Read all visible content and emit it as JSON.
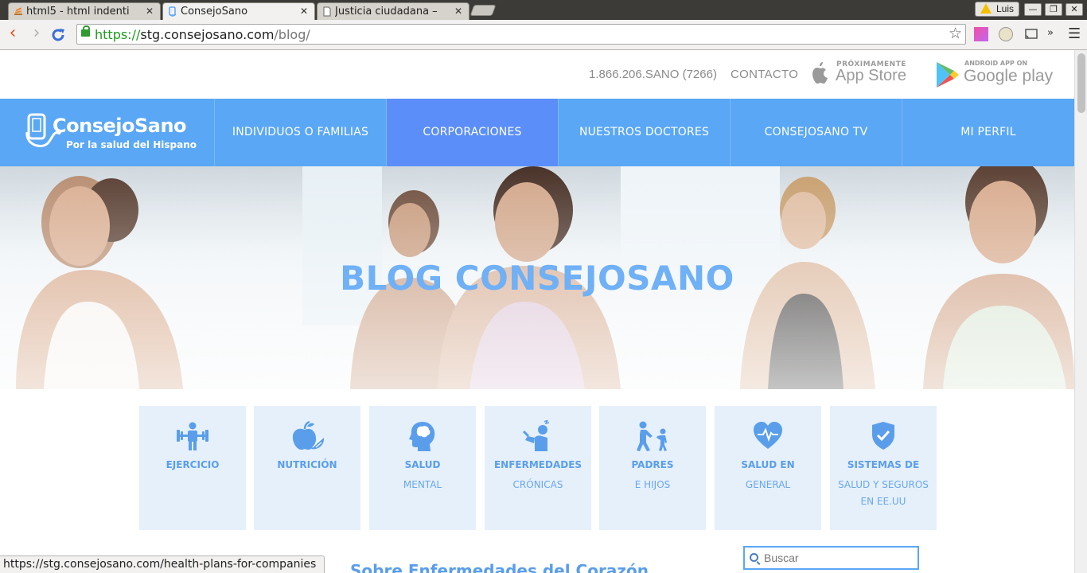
{
  "browser": {
    "tabs": [
      {
        "title": "html5 - html indenti",
        "active": false,
        "icon": "stackoverflow-icon"
      },
      {
        "title": "ConsejoSano",
        "active": true,
        "icon": "consejosano-favicon"
      },
      {
        "title": "Justicia ciudadana –",
        "active": false,
        "icon": "page-icon"
      }
    ],
    "profile_name": "Luis",
    "url_scheme": "https://",
    "url_host": "stg.consejosano.com",
    "url_path": "/blog/",
    "status_url": "https://stg.consejosano.com/health-plans-for-companies",
    "colors": {
      "secure": "#1c9a1c",
      "tab_active": "#f2f1f0"
    }
  },
  "header": {
    "phone": "1.866.206.SANO (7266)",
    "contact": "CONTACTO",
    "appstore_small": "PRÓXIMAMENTE",
    "appstore_big": "App Store",
    "gplay_small": "ANDROID APP ON",
    "gplay_big": "Google play"
  },
  "nav": {
    "brand": "ConsejoSano",
    "tagline": "Por la salud del Hispano",
    "items": [
      {
        "label": "INDIVIDUOS O FAMILIAS",
        "active": false
      },
      {
        "label": "CORPORACIONES",
        "active": true
      },
      {
        "label": "NUESTROS DOCTORES",
        "active": false
      },
      {
        "label": "CONSEJOSANO TV",
        "active": false
      },
      {
        "label": "MI PERFIL",
        "active": false
      }
    ],
    "colors": {
      "bar": "#5aa7f6",
      "active": "#5b8ef9"
    }
  },
  "hero": {
    "title": "BLOG CONSEJOSANO"
  },
  "categories": [
    {
      "line1": "EJERCICIO",
      "line2": "",
      "line3": "",
      "icon": "dumbbell-person-icon"
    },
    {
      "line1": "NUTRICIÓN",
      "line2": "",
      "line3": "",
      "icon": "apple-icon"
    },
    {
      "line1": "SALUD",
      "line2": "MENTAL",
      "line3": "",
      "icon": "head-brain-icon"
    },
    {
      "line1": "ENFERMEDADES",
      "line2": "CRÓNICAS",
      "line3": "",
      "icon": "sick-person-icon"
    },
    {
      "line1": "PADRES",
      "line2": "E HIJOS",
      "line3": "",
      "icon": "parent-child-icon"
    },
    {
      "line1": "SALUD EN",
      "line2": "GENERAL",
      "line3": "",
      "icon": "heart-pulse-icon"
    },
    {
      "line1": "SISTEMAS DE",
      "line2": "SALUD Y SEGUROS",
      "line3": "EN EE.UU",
      "icon": "shield-check-icon"
    }
  ],
  "post": {
    "title": "Sobre Enfermedades del Corazón"
  },
  "search": {
    "placeholder": "Buscar"
  }
}
